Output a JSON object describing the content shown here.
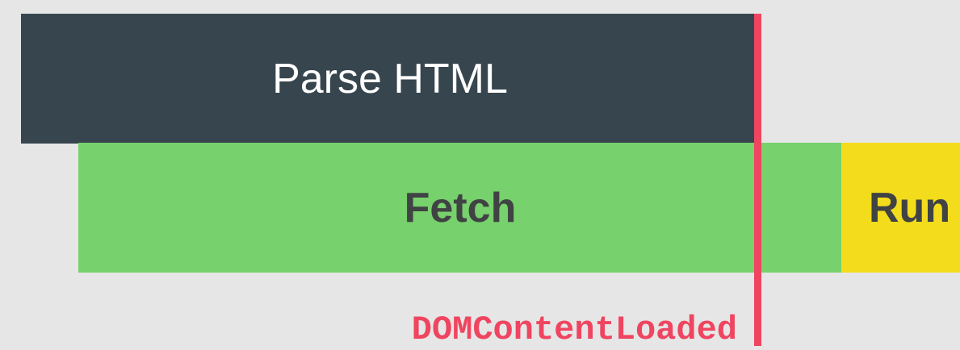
{
  "bars": {
    "parse_label": "Parse HTML",
    "fetch_label": "Fetch",
    "run_label": "Run"
  },
  "marker": {
    "label": "DOMContentLoaded"
  },
  "colors": {
    "background": "#e6e6e6",
    "parse": "#37454e",
    "fetch": "#77d16c",
    "run": "#f3dc1b",
    "marker": "#ef4560"
  }
}
